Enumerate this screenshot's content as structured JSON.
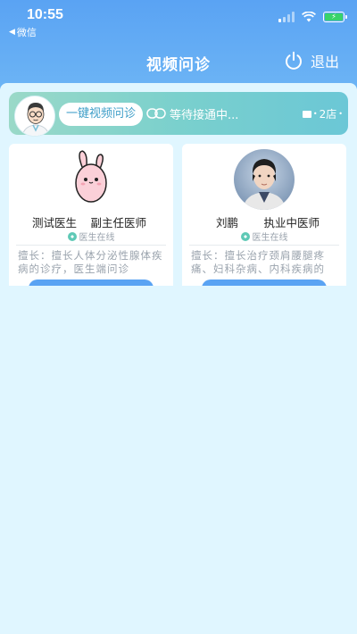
{
  "status_bar": {
    "time": "10:55",
    "back_label": "微信"
  },
  "header": {
    "title": "视频问诊",
    "exit_label": "退出"
  },
  "banner": {
    "button_label": "一键视频问诊",
    "waiting_text": "等待接通中...",
    "store_text": "2店"
  },
  "doctors": [
    {
      "name": "测试医生",
      "rank": "副主任医师",
      "status": "医生在线",
      "skill": "擅长：擅长人体分泌性腺体疾病的诊疗，医生端问诊"
    },
    {
      "name": "刘鹏",
      "rank": "执业中医师",
      "status": "医生在线",
      "skill": "擅长：擅长治疗颈肩腰腿疼痛、妇科杂病、内科疾病的"
    }
  ],
  "colors": {
    "header_blue": "#5aa3f3",
    "banner_teal": "#7ad0cd",
    "page_bg": "#e0f6ff",
    "online_green": "#5fc9b6"
  },
  "icons": {
    "power": "power-icon",
    "link": "link-icon",
    "store": "store-icon"
  }
}
